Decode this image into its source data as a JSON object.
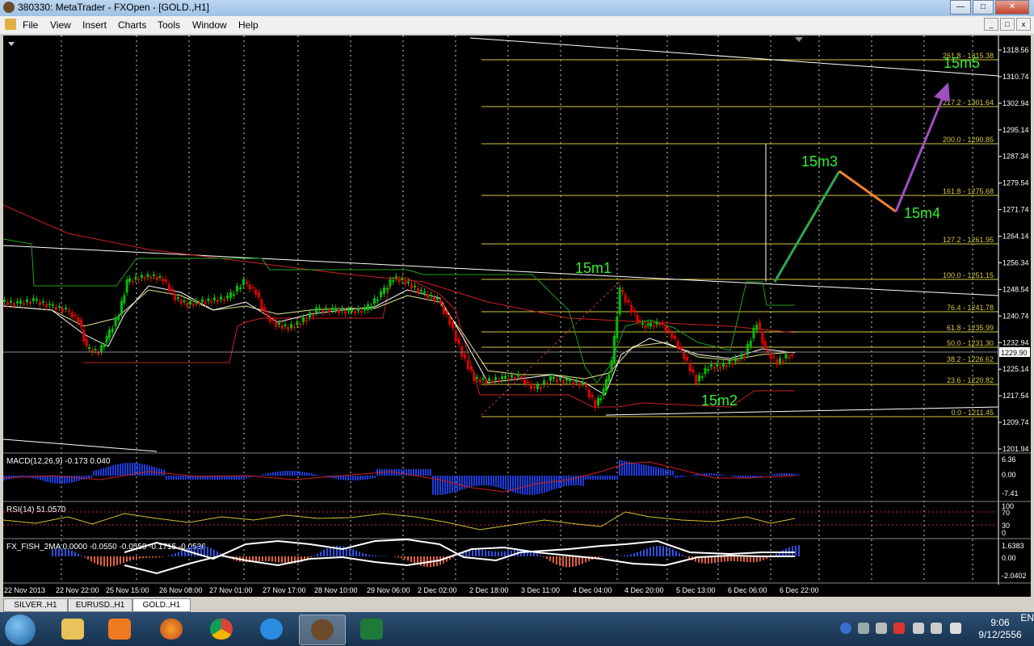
{
  "window": {
    "title": "380330: MetaTrader - FXOpen - [GOLD.,H1]"
  },
  "menu": [
    "File",
    "View",
    "Insert",
    "Charts",
    "Tools",
    "Window",
    "Help"
  ],
  "chart": {
    "price_axis": [
      "1318.56",
      "1310.74",
      "1302.94",
      "1295.14",
      "1287.34",
      "1279.54",
      "1271.74",
      "1264.14",
      "1256.34",
      "1248.54",
      "1240.74",
      "1232.94",
      "1225.14",
      "1217.54",
      "1209.74",
      "1201.94"
    ],
    "current_price": "1229.90",
    "fib_levels": [
      "261.8 - 1315.38",
      "217.2 - 1301.64",
      "200.0 - 1290.85",
      "161.8 - 1275.68",
      "127.2 - 1261.95",
      "100.0 - 1251.15",
      "76.4 - 1241.78",
      "61.8 - 1235.99",
      "50.0 - 1231.30",
      "38.2 - 1226.62",
      "23.6 - 1220.82",
      "0.0 - 1211.45"
    ],
    "annotations": [
      "15m1",
      "15m2",
      "15m3",
      "15m4",
      "15m5"
    ],
    "time_axis": [
      "22 Nov 2013",
      "22 Nov 22:00",
      "25 Nov 15:00",
      "26 Nov 08:00",
      "27 Nov 01:00",
      "27 Nov 17:00",
      "28 Nov 10:00",
      "29 Nov 06:00",
      "2 Dec 02:00",
      "2 Dec 18:00",
      "3 Dec 11:00",
      "4 Dec 04:00",
      "4 Dec 20:00",
      "5 Dec 13:00",
      "6 Dec 06:00",
      "6 Dec 22:00"
    ],
    "colors": {
      "background": "#000000",
      "fib": "#d4c840",
      "up_candle": "#00c000",
      "down_candle": "#e00000",
      "annotation": "#33ee33"
    }
  },
  "indicators": {
    "macd": {
      "label": "MACD(12,26,9) -0.173 0.040",
      "scale": [
        "6.36",
        "0.00",
        "-7.41"
      ]
    },
    "rsi": {
      "label": "RSI(14) 51.0570",
      "scale": [
        "100",
        "70",
        "30",
        "0"
      ]
    },
    "fisher": {
      "label": "FX_FISH_2MA 0.0000 -0.0550 -0.0550 -0.1715 -0.0536",
      "scale": [
        "1.6383",
        "0.00",
        "-2.0402"
      ]
    }
  },
  "tabs": [
    "SILVER.,H1",
    "EURUSD.,H1",
    "GOLD.,H1"
  ],
  "taskbar": {
    "language": "EN",
    "time": "9:06",
    "date": "9/12/2556",
    "apps": [
      "explorer",
      "media-player",
      "firefox",
      "chrome",
      "internet-explorer",
      "metatrader",
      "excel"
    ]
  }
}
